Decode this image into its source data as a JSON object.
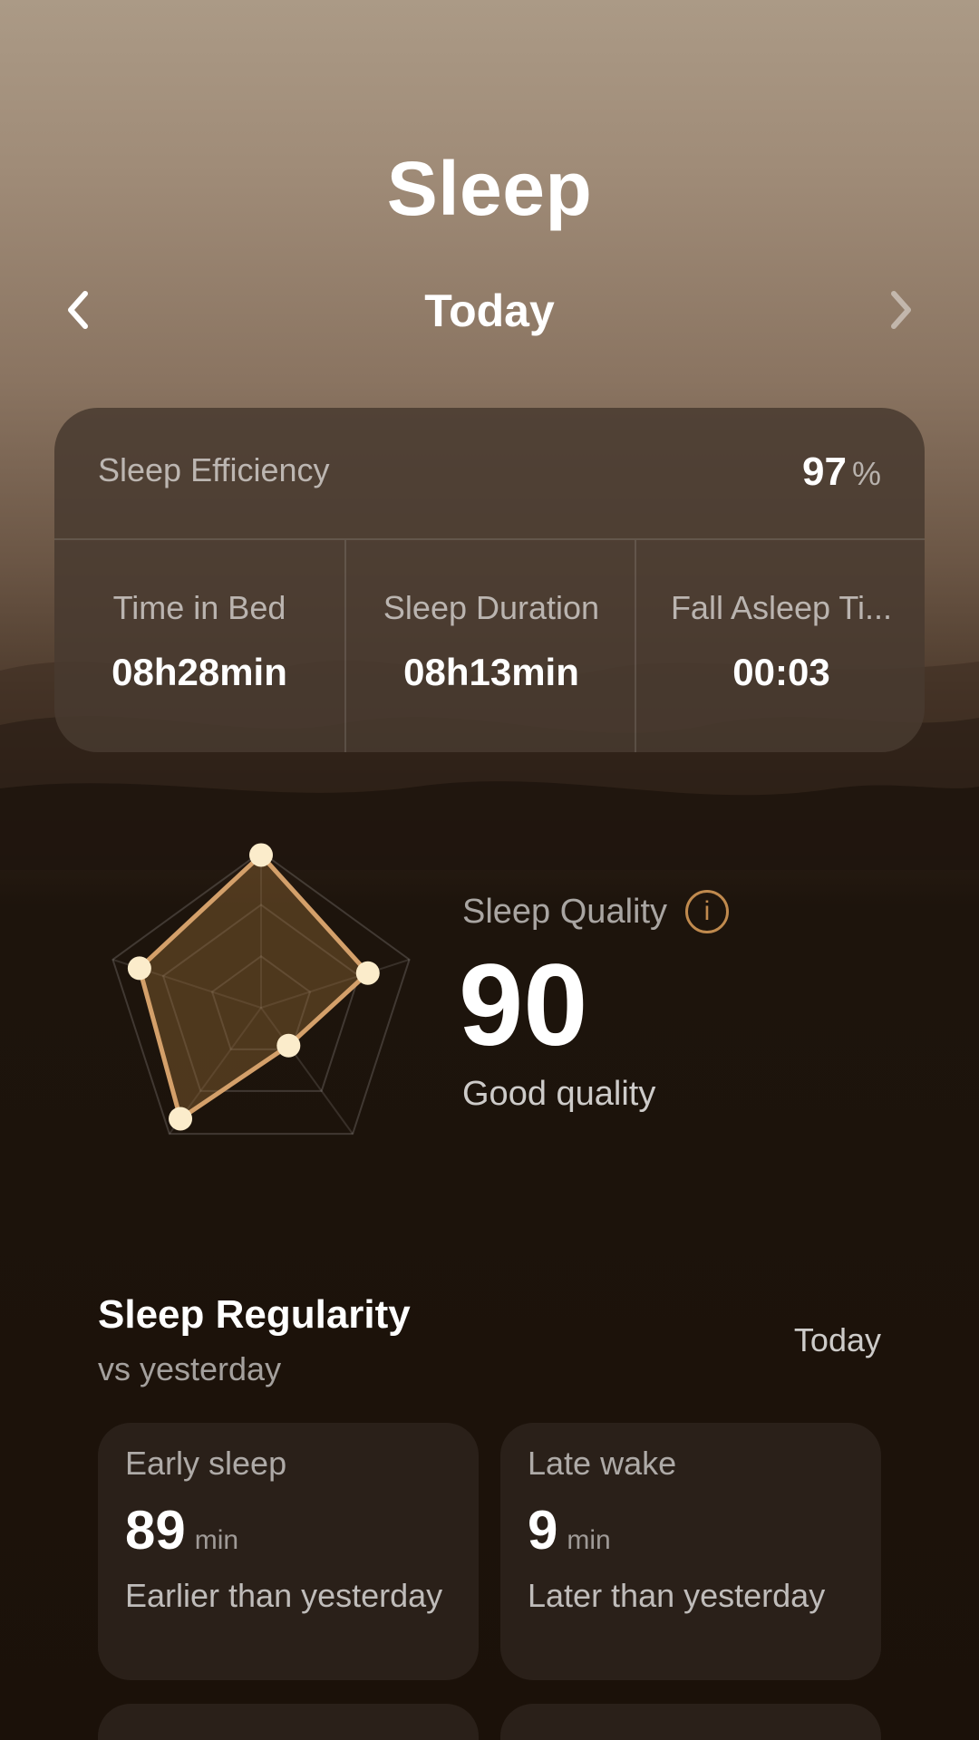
{
  "page": {
    "title": "Sleep",
    "period_label": "Today"
  },
  "icons": {
    "prev": "chevron-left-icon",
    "next": "chevron-right-icon",
    "info": "info-icon"
  },
  "summary": {
    "efficiency_label": "Sleep Efficiency",
    "efficiency_value": "97",
    "efficiency_unit": "%",
    "stats": [
      {
        "label": "Time in Bed",
        "value": "08h28min"
      },
      {
        "label": "Sleep Duration",
        "value": "08h13min"
      },
      {
        "label": "Fall Asleep Ti...",
        "value": "00:03"
      }
    ]
  },
  "quality": {
    "title": "Sleep Quality",
    "info_glyph": "i",
    "score": "90",
    "description": "Good quality",
    "radar_levels": [
      0.98,
      0.72,
      0.3,
      0.88,
      0.82
    ],
    "accent_color": "#d4a06a",
    "point_color": "#fbeccb"
  },
  "regularity": {
    "title": "Sleep Regularity",
    "subtitle": "vs yesterday",
    "period": "Today",
    "cards": [
      {
        "label": "Early sleep",
        "value": "89",
        "unit": "min",
        "description": "Earlier than yesterday"
      },
      {
        "label": "Late wake",
        "value": "9",
        "unit": "min",
        "description": "Later than yesterday"
      }
    ]
  }
}
